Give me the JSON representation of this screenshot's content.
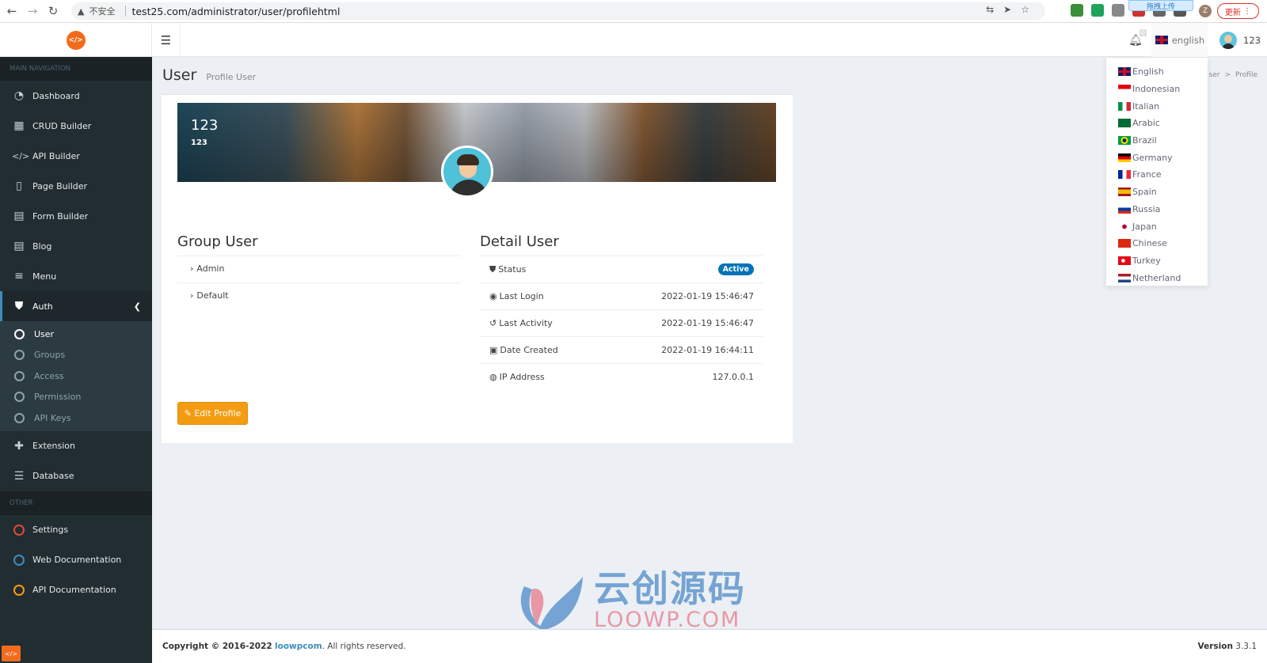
{
  "browser": {
    "security_label": "不安全",
    "url": "test25.com/administrator/user/profilehtml",
    "upload_badge": "拖拽上传",
    "profile_initial": "Z",
    "update_label": "更新"
  },
  "header": {
    "notification_count": "0",
    "language": "english",
    "username": "123"
  },
  "sidebar": {
    "main_header": "MAIN NAVIGATION",
    "items": [
      {
        "label": "Dashboard",
        "icon": "dashboard-icon"
      },
      {
        "label": "CRUD Builder",
        "icon": "table-icon"
      },
      {
        "label": "API Builder",
        "icon": "code-icon"
      },
      {
        "label": "Page Builder",
        "icon": "file-icon"
      },
      {
        "label": "Form Builder",
        "icon": "newspaper-icon"
      },
      {
        "label": "Blog",
        "icon": "file-text-icon"
      },
      {
        "label": "Menu",
        "icon": "bars-icon"
      },
      {
        "label": "Auth",
        "icon": "shield-icon"
      }
    ],
    "auth_sub": [
      {
        "label": "User"
      },
      {
        "label": "Groups"
      },
      {
        "label": "Access"
      },
      {
        "label": "Permission"
      },
      {
        "label": "API Keys"
      }
    ],
    "items_after": [
      {
        "label": "Extension",
        "icon": "puzzle-icon"
      },
      {
        "label": "Database",
        "icon": "database-icon"
      }
    ],
    "other_header": "OTHER",
    "other_items": [
      {
        "label": "Settings",
        "color": "#dd4b39"
      },
      {
        "label": "Web Documentation",
        "color": "#3c8dbc"
      },
      {
        "label": "API Documentation",
        "color": "#f39c12"
      }
    ]
  },
  "page": {
    "title": "User",
    "subtitle": "Profile User",
    "breadcrumb": [
      "User",
      ">",
      "Profile"
    ]
  },
  "profile": {
    "name": "123",
    "username": "123",
    "group_title": "Group User",
    "groups": [
      "Admin",
      "Default"
    ],
    "detail_title": "Detail User",
    "details": [
      {
        "label": "Status",
        "value": "Active",
        "icon": "shield-icon"
      },
      {
        "label": "Last Login",
        "value": "2022-01-19 15:46:47",
        "icon": "compass-icon"
      },
      {
        "label": "Last Activity",
        "value": "2022-01-19 15:46:47",
        "icon": "history-icon"
      },
      {
        "label": "Date Created",
        "value": "2022-01-19 16:44:11",
        "icon": "calendar-icon"
      },
      {
        "label": "IP Address",
        "value": "127.0.0.1",
        "icon": "globe-icon"
      }
    ],
    "edit_label": "Edit Profile"
  },
  "languages": [
    "English",
    "Indonesian",
    "Italian",
    "Arabic",
    "Brazil",
    "Germany",
    "France",
    "Spain",
    "Russia",
    "Japan",
    "Chinese",
    "Turkey",
    "Netherland"
  ],
  "watermark": {
    "main": "云创源码",
    "sub": "LOOWP.COM"
  },
  "footer": {
    "copyright_prefix": "Copyright © 2016-2022",
    "company": "loowpcom",
    "rights": ". All rights reserved.",
    "version_label": "Version",
    "version": "3.3.1"
  },
  "colors": {
    "sidebar_bg": "#222d32",
    "accent": "#3c8dbc",
    "edit_button": "#f39c12",
    "active_badge": "#0073b7",
    "logo": "#f26b1d"
  }
}
